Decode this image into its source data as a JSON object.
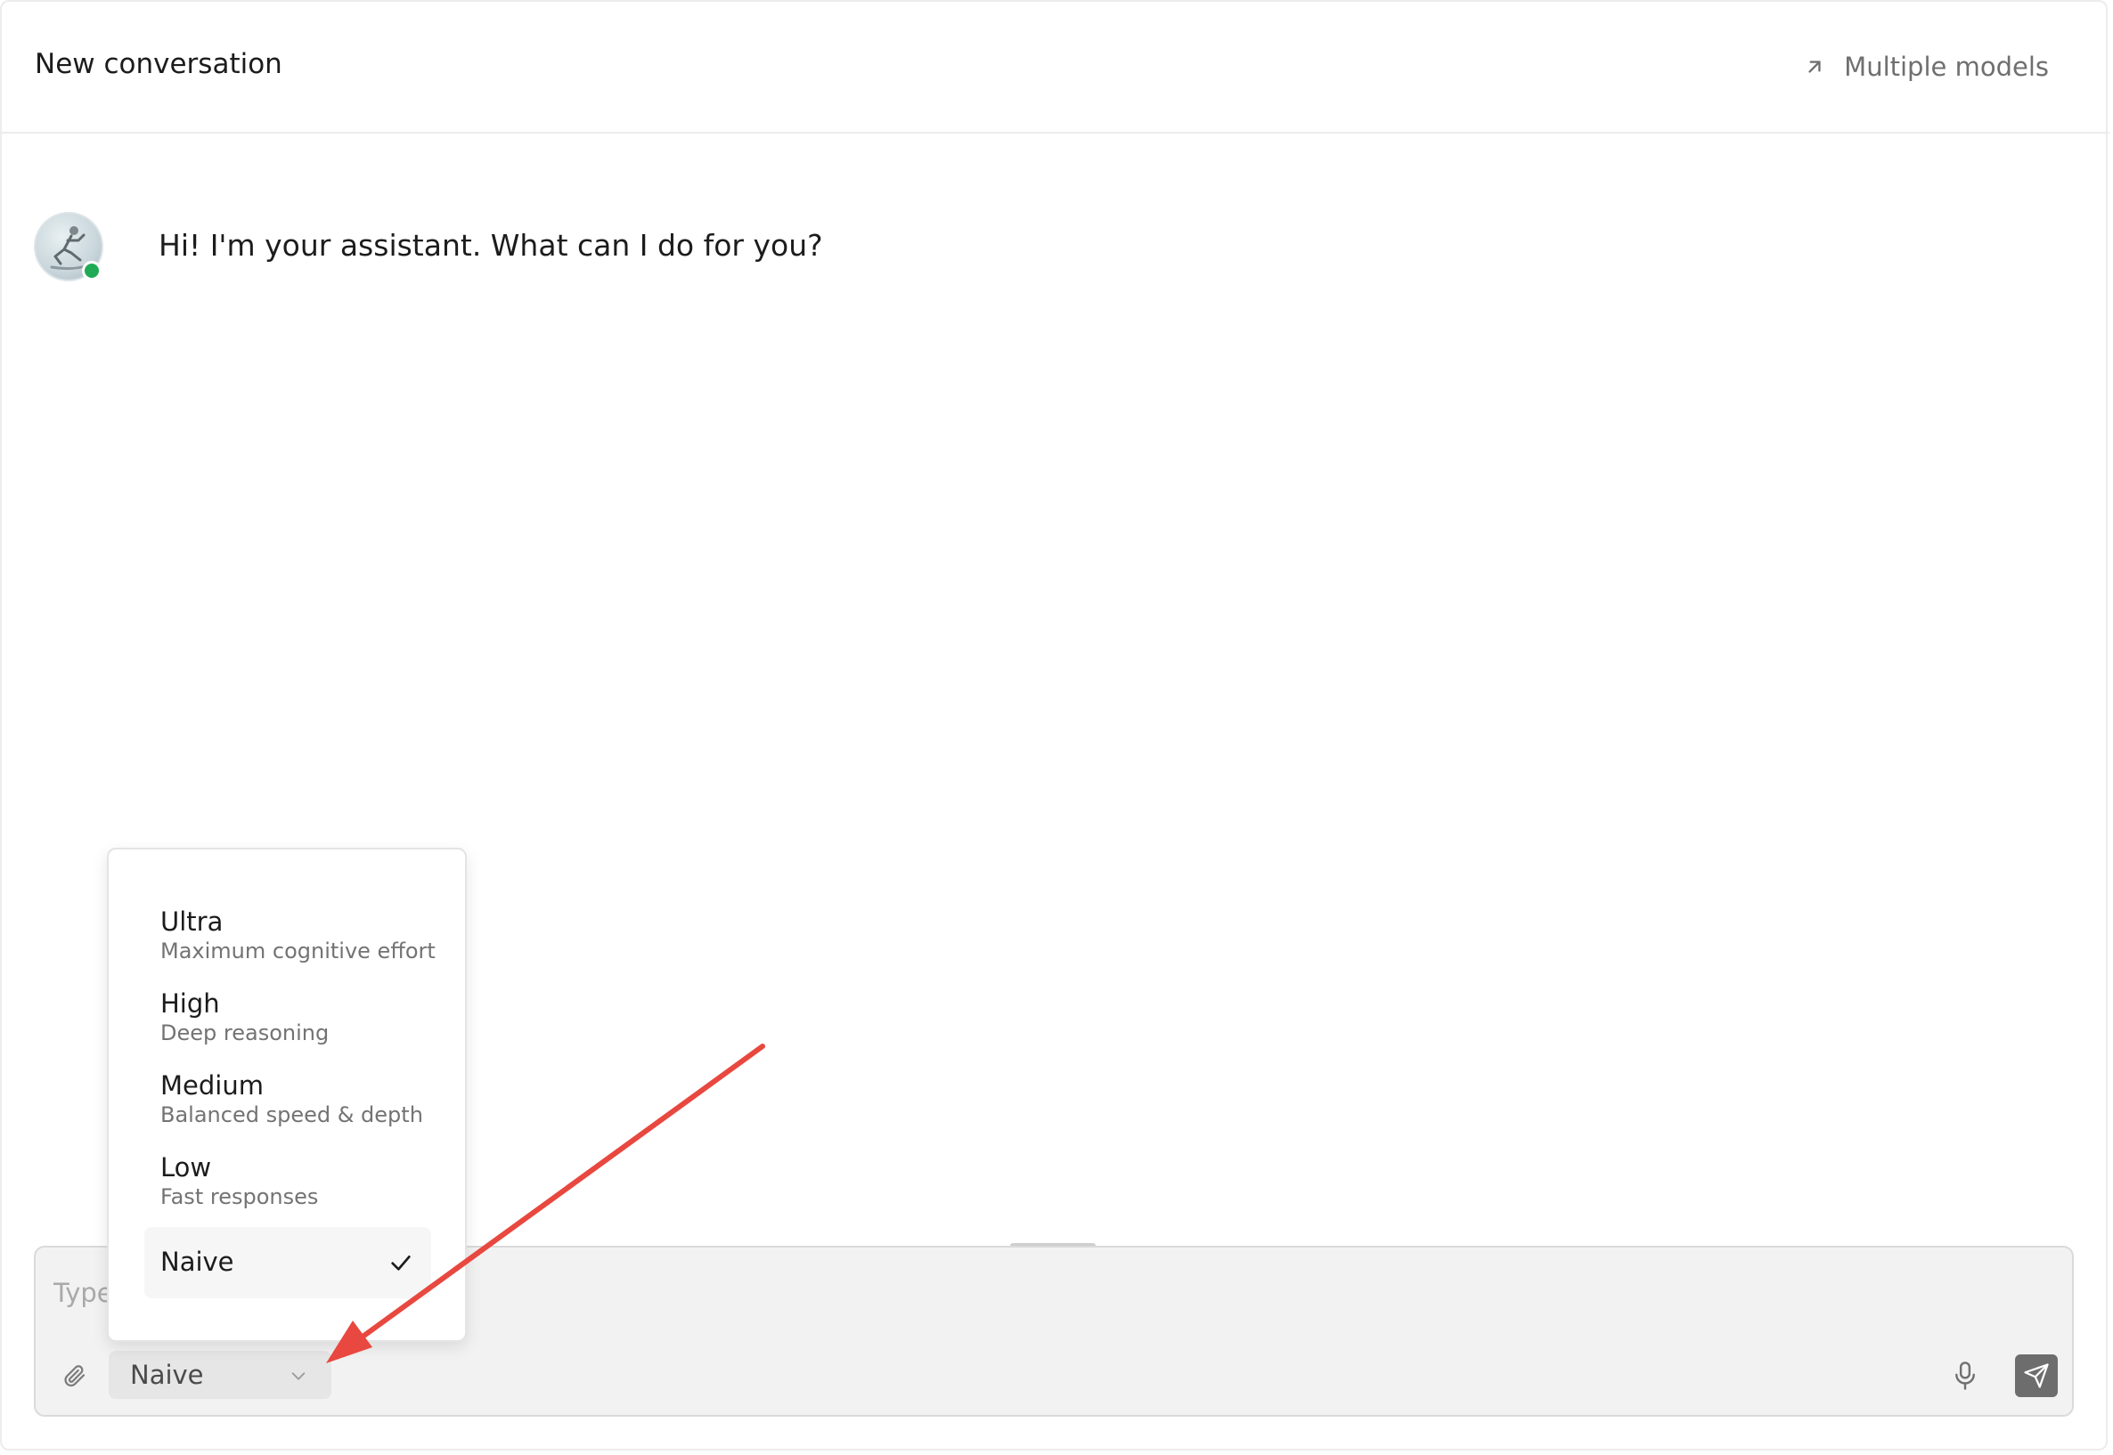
{
  "header": {
    "title": "New conversation",
    "models_button_label": "Multiple models"
  },
  "chat": {
    "assistant_message": "Hi! I'm your assistant. What can I do for you?",
    "assistant_status": "online"
  },
  "composer": {
    "placeholder": "Type",
    "effort_selected": "Naive"
  },
  "effort_menu": {
    "options": [
      {
        "name": "Ultra",
        "description": "Maximum cognitive effort"
      },
      {
        "name": "High",
        "description": "Deep reasoning"
      },
      {
        "name": "Medium",
        "description": "Balanced speed & depth"
      },
      {
        "name": "Low",
        "description": "Fast responses"
      },
      {
        "name": "Naive",
        "description": ""
      }
    ],
    "selected_index": 4
  },
  "icons": {
    "models": "arrow-up-right-icon",
    "attach": "paperclip-icon",
    "select_caret": "chevron-down-icon",
    "mic": "microphone-icon",
    "send": "send-icon",
    "check": "check-icon"
  },
  "colors": {
    "status_online": "#1faa55",
    "annotation_arrow": "#e8483f",
    "send_button": "#6d6d6d"
  }
}
